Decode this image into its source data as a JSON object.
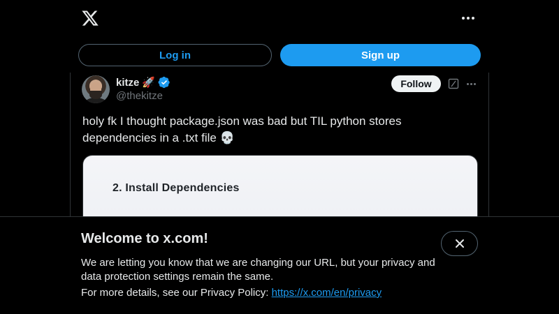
{
  "header": {
    "logo_icon": "x-logo-icon",
    "more_icon": "more-horizontal-icon"
  },
  "auth": {
    "login_label": "Log in",
    "signup_label": "Sign up"
  },
  "tweet": {
    "author_name": "kitze",
    "author_emoji": "🚀",
    "verified_icon": "verified-badge-icon",
    "handle": "@thekitze",
    "follow_label": "Follow",
    "grok_icon": "grok-icon",
    "more_icon": "more-horizontal-icon",
    "text": "holy fk I thought package.json was bad but TIL python stores dependencies in a .txt file 💀",
    "media": {
      "heading": "2. Install Dependencies"
    }
  },
  "banner": {
    "title": "Welcome to x.com!",
    "body": "We are letting you know that we are changing our URL, but your privacy and data protection settings remain the same.",
    "details_prefix": "For more details, see our Privacy Policy: ",
    "privacy_link": "https://x.com/en/privacy",
    "close_icon": "close-icon"
  },
  "colors": {
    "accent": "#1d9bf0",
    "background": "#000000",
    "text": "#e7e9ea",
    "muted": "#71767b"
  }
}
